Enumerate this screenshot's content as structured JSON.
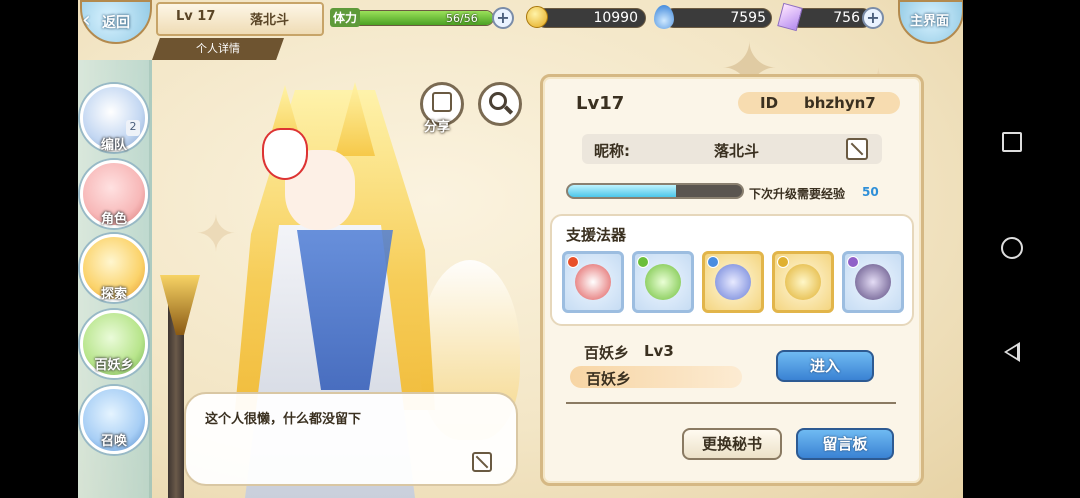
{
  "header": {
    "back_label": "返回",
    "player_level": "Lv 17",
    "player_name": "落北斗",
    "subtab_label": "个人详情",
    "stamina_label": "体力",
    "stamina_text": "56/56",
    "stamina_fraction": 1.0,
    "gold": "10990",
    "spirit": "7595",
    "crystal": "756",
    "home_label": "主界面"
  },
  "sidebar": {
    "items": [
      {
        "label": "编队",
        "badge": "2"
      },
      {
        "label": "角色"
      },
      {
        "label": "探索"
      },
      {
        "label": "百妖乡"
      },
      {
        "label": "召唤"
      }
    ]
  },
  "character": {
    "share_label": "分享",
    "bio": "这个人很懒，什么都没留下"
  },
  "profile": {
    "level": "Lv17",
    "id_label": "ID",
    "id_value": "bhzhyn7",
    "nickname_label": "昵称:",
    "nickname_value": "落北斗",
    "exp_label": "下次升级需要经验",
    "exp_value": "50",
    "exp_fraction": 0.62,
    "support_title": "支援法器",
    "support_slots": [
      {
        "icon": "bracelet-icon",
        "rarity": "blue",
        "gem_color": "#e8502a"
      },
      {
        "icon": "leaf-ornament-icon",
        "rarity": "blue",
        "gem_color": "#6bbf3a"
      },
      {
        "icon": "dragon-ornament-icon",
        "rarity": "gold",
        "gem_color": "#4a8de0"
      },
      {
        "icon": "sword-icon",
        "rarity": "gold",
        "gem_color": "#e0b030"
      },
      {
        "icon": "dark-ring-icon",
        "rarity": "blue",
        "gem_color": "#9060c8"
      }
    ],
    "village_label": "百妖乡",
    "village_level": "Lv3",
    "village_name": "百妖乡",
    "enter_label": "进入",
    "secretary_label": "更换秘书",
    "board_label": "留言板"
  },
  "colors": {
    "accent_blue": "#3a82d3",
    "stamina_green": "#4ba123",
    "exp_cyan": "#4cc6e9"
  }
}
